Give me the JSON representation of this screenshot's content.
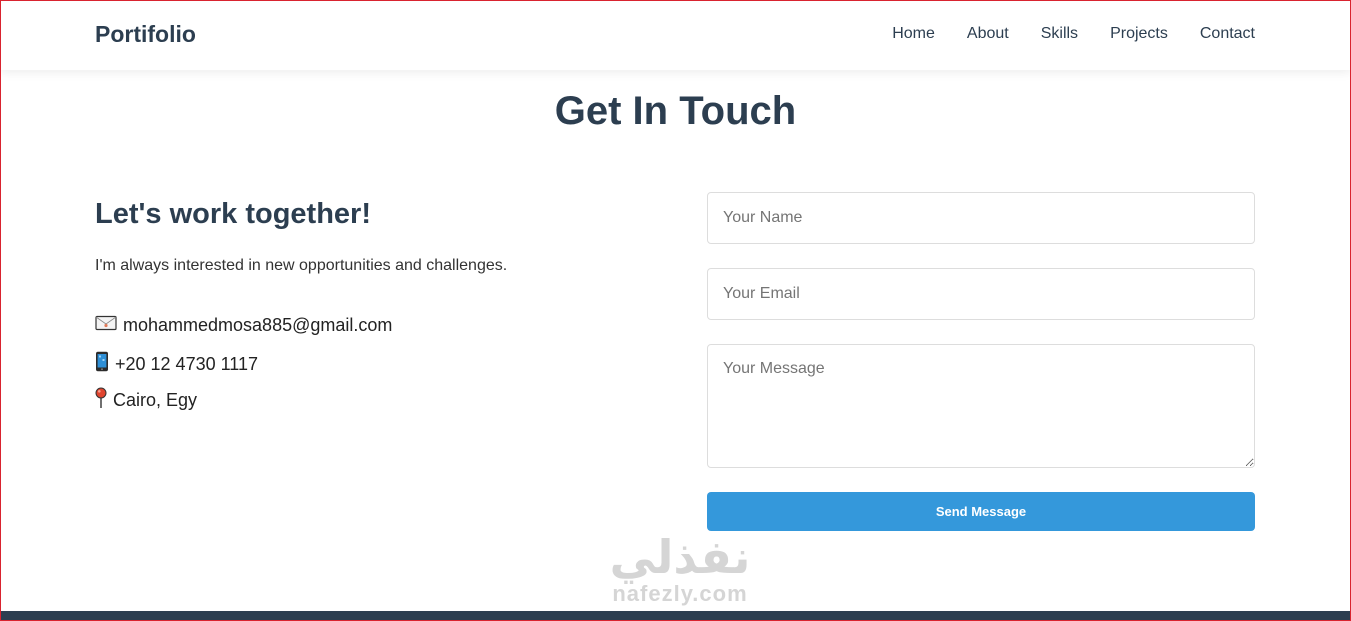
{
  "header": {
    "brand": "Portifolio",
    "nav": [
      "Home",
      "About",
      "Skills",
      "Projects",
      "Contact"
    ]
  },
  "section": {
    "title": "Get In Touch"
  },
  "info": {
    "heading": "Let's work together!",
    "text": "I'm always interested in new opportunities and challenges.",
    "email": "mohammedmosa885@gmail.com",
    "phone": "+20 12 4730 1117",
    "location": "Cairo, Egy"
  },
  "form": {
    "name_placeholder": "Your Name",
    "email_placeholder": "Your Email",
    "message_placeholder": "Your Message",
    "submit_label": "Send Message"
  },
  "watermark": {
    "arabic": "نفذلي",
    "latin": "nafezly.com"
  },
  "colors": {
    "primary": "#2c3e50",
    "accent": "#3498db",
    "frame": "#d9232f"
  },
  "icons": {
    "email": "envelope-icon",
    "phone": "mobile-phone-icon",
    "location": "pushpin-icon"
  }
}
